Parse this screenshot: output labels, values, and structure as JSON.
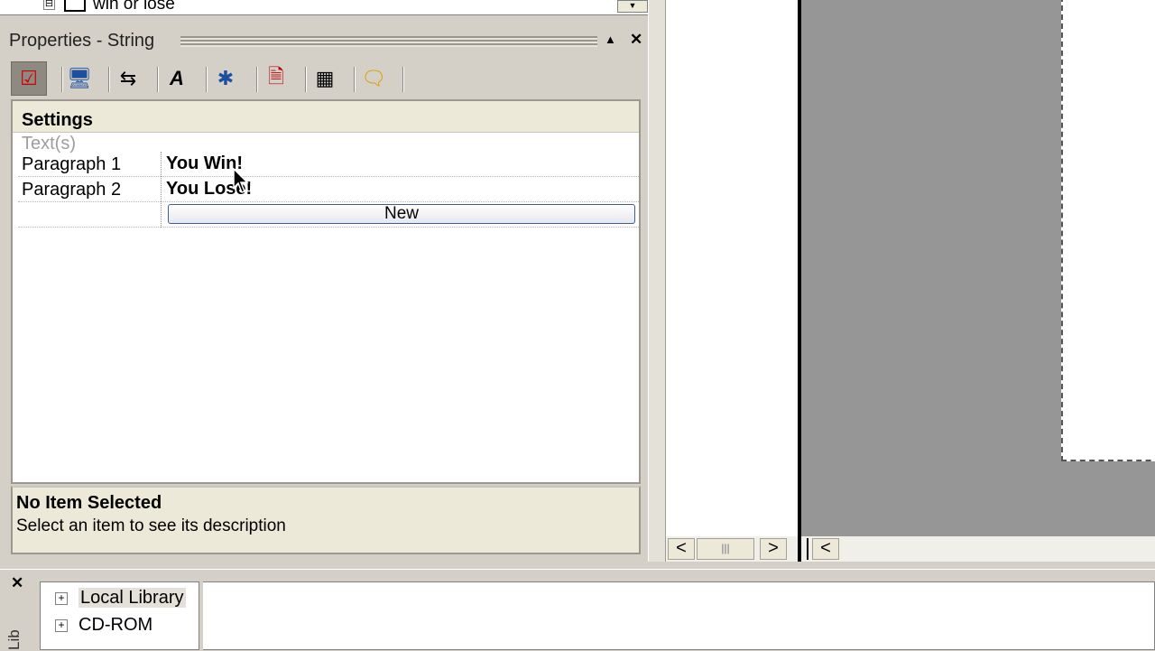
{
  "top_tree": {
    "node_label": "win or lose",
    "toggle": "⊟",
    "dropdown_glyph": "▼"
  },
  "properties": {
    "title": "Properties - String",
    "pin_glyph": "▲",
    "close_glyph": "✕",
    "toolbar": [
      {
        "name": "checklist-icon",
        "glyph": "☑",
        "active": true
      },
      {
        "name": "monitor-icon",
        "glyph": "🖥"
      },
      {
        "name": "move-arrows-icon",
        "glyph": "⇆"
      },
      {
        "name": "font-icon",
        "glyph": "A"
      },
      {
        "name": "actor-icon",
        "glyph": "✱"
      },
      {
        "name": "page-icon",
        "glyph": "🗎"
      },
      {
        "name": "grid-table-icon",
        "glyph": "▦"
      },
      {
        "name": "note-icon",
        "glyph": "🗨"
      }
    ],
    "grid": {
      "section_header": "Settings",
      "group_label": "Text(s)",
      "rows": [
        {
          "label": "Paragraph 1",
          "value": "You Win!"
        },
        {
          "label": "Paragraph 2",
          "value": "You Lose!"
        }
      ],
      "new_button_label": "New"
    },
    "description": {
      "title": "No Item Selected",
      "text": "Select an item to see its description"
    }
  },
  "scrollbar": {
    "left_glyph": "<",
    "thumb_glyph": "|||",
    "right_glyph": ">"
  },
  "library": {
    "close_glyph": "✕",
    "tab_label": "Lib",
    "items": [
      {
        "label": "Local Library",
        "toggle": "+"
      },
      {
        "label": "CD-ROM",
        "toggle": "+"
      }
    ]
  }
}
